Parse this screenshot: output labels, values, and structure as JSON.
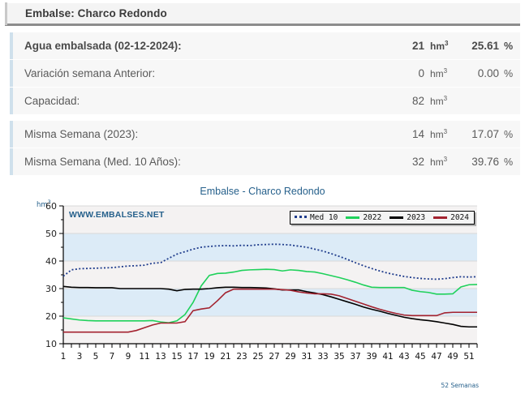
{
  "header": {
    "title": "Embalse: Charco Redondo"
  },
  "table": {
    "rows": [
      {
        "label": "Agua embalsada (02-12-2024):",
        "value": "21",
        "unit": "hm",
        "unit_sup": "3",
        "pct": "25.61",
        "pct_symbol": "%",
        "bold": true
      },
      {
        "label": "Variación semana Anterior:",
        "value": "0",
        "unit": "hm",
        "unit_sup": "3",
        "pct": "0.00",
        "pct_symbol": "%",
        "bold": false
      },
      {
        "label": "Capacidad:",
        "value": "82",
        "unit": "hm",
        "unit_sup": "3",
        "pct": "",
        "pct_symbol": "",
        "bold": false
      },
      {
        "label": "Misma Semana (2023):",
        "value": "14",
        "unit": "hm",
        "unit_sup": "3",
        "pct": "17.07",
        "pct_symbol": "%",
        "bold": false
      },
      {
        "label": "Misma Semana (Med. 10 Años):",
        "value": "32",
        "unit": "hm",
        "unit_sup": "3",
        "pct": "39.76",
        "pct_symbol": "%",
        "bold": false
      }
    ]
  },
  "chart": {
    "title": "Embalse - Charco Redondo",
    "y_unit": "hm",
    "y_unit_sup": "3",
    "watermark": "WWW.EMBALSES.NET",
    "x_caption": "52 Semanas",
    "legend": [
      {
        "label": "Med 10",
        "color": "#1f3c8c",
        "style": "dotted"
      },
      {
        "label": "2022",
        "color": "#1fd15b",
        "style": "solid"
      },
      {
        "label": "2023",
        "color": "#000000",
        "style": "solid"
      },
      {
        "label": "2024",
        "color": "#a3222f",
        "style": "solid"
      }
    ],
    "colors": {
      "title": "#27618c",
      "band": "#dcebf7",
      "plot_bg": "#f4f2f2",
      "gridline": "#d8d8d8",
      "axis": "#000000"
    }
  },
  "chart_data": {
    "type": "line",
    "title": "Embalse - Charco Redondo",
    "xlabel": "52 Semanas",
    "ylabel": "hm3",
    "xlim": [
      1,
      52
    ],
    "ylim": [
      10,
      60
    ],
    "yticks": [
      10,
      20,
      30,
      40,
      50,
      60
    ],
    "xticks": [
      1,
      3,
      5,
      7,
      9,
      11,
      13,
      15,
      17,
      19,
      21,
      23,
      25,
      27,
      29,
      31,
      33,
      35,
      37,
      39,
      41,
      43,
      45,
      47,
      49,
      51
    ],
    "grid": true,
    "legend_position": "top-right",
    "x": [
      1,
      2,
      3,
      4,
      5,
      6,
      7,
      8,
      9,
      10,
      11,
      12,
      13,
      14,
      15,
      16,
      17,
      18,
      19,
      20,
      21,
      22,
      23,
      24,
      25,
      26,
      27,
      28,
      29,
      30,
      31,
      32,
      33,
      34,
      35,
      36,
      37,
      38,
      39,
      40,
      41,
      42,
      43,
      44,
      45,
      46,
      47,
      48,
      49,
      50,
      51,
      52
    ],
    "series": [
      {
        "name": "Med 10",
        "color": "#1f3c8c",
        "style": "dotted",
        "values": [
          34.5,
          36.8,
          37.2,
          37.3,
          37.4,
          37.5,
          37.6,
          37.9,
          38.2,
          38.3,
          38.5,
          39.2,
          39.4,
          41.0,
          42.5,
          43.4,
          44.3,
          45.0,
          45.3,
          45.5,
          45.6,
          45.5,
          45.7,
          45.6,
          45.9,
          46.0,
          46.1,
          46.0,
          45.8,
          45.4,
          45.0,
          44.3,
          43.6,
          42.7,
          41.7,
          40.6,
          39.4,
          38.3,
          37.3,
          36.4,
          35.6,
          35.0,
          34.4,
          34.0,
          33.7,
          33.5,
          33.4,
          33.6,
          34.0,
          34.3,
          34.2,
          34.3
        ]
      },
      {
        "name": "2022",
        "color": "#1fd15b",
        "style": "solid",
        "values": [
          19.4,
          19.0,
          18.6,
          18.4,
          18.3,
          18.3,
          18.3,
          18.3,
          18.3,
          18.3,
          18.3,
          18.4,
          17.9,
          17.6,
          18.3,
          20.6,
          25.0,
          31.0,
          34.8,
          35.5,
          35.6,
          36.0,
          36.6,
          36.8,
          36.9,
          37.0,
          36.9,
          36.4,
          36.8,
          36.6,
          36.2,
          36.0,
          35.4,
          34.7,
          34.0,
          33.2,
          32.3,
          31.3,
          30.5,
          30.4,
          30.4,
          30.4,
          30.4,
          29.4,
          28.9,
          28.6,
          28.0,
          28.0,
          28.1,
          30.6,
          31.4,
          31.5
        ]
      },
      {
        "name": "2023",
        "color": "#000000",
        "style": "solid",
        "values": [
          30.8,
          30.5,
          30.4,
          30.4,
          30.3,
          30.3,
          30.3,
          30.0,
          30.0,
          30.0,
          30.0,
          30.0,
          30.0,
          29.8,
          29.2,
          29.7,
          29.8,
          29.8,
          30.0,
          30.3,
          30.5,
          30.5,
          30.4,
          30.4,
          30.3,
          30.2,
          29.9,
          29.5,
          29.5,
          29.5,
          28.9,
          28.4,
          27.8,
          27.0,
          26.1,
          25.2,
          24.3,
          23.3,
          22.5,
          21.8,
          21.0,
          20.3,
          19.6,
          19.1,
          18.7,
          18.4,
          18.0,
          17.5,
          17.0,
          16.3,
          16.1,
          16.1
        ]
      },
      {
        "name": "2024",
        "color": "#a3222f",
        "style": "solid",
        "values": [
          14.2,
          14.2,
          14.2,
          14.2,
          14.2,
          14.2,
          14.2,
          14.2,
          14.2,
          14.8,
          15.8,
          16.8,
          17.5,
          17.5,
          17.5,
          18.0,
          22.0,
          22.6,
          23.0,
          25.6,
          28.5,
          29.8,
          29.8,
          29.8,
          29.8,
          29.8,
          29.8,
          29.6,
          29.4,
          28.8,
          28.4,
          28.1,
          28.1,
          28.0,
          27.4,
          26.4,
          25.4,
          24.4,
          23.4,
          22.5,
          21.7,
          21.0,
          20.4,
          20.2,
          20.2,
          20.2,
          20.2,
          21.2,
          21.4,
          21.4,
          21.4,
          21.4
        ]
      }
    ]
  }
}
